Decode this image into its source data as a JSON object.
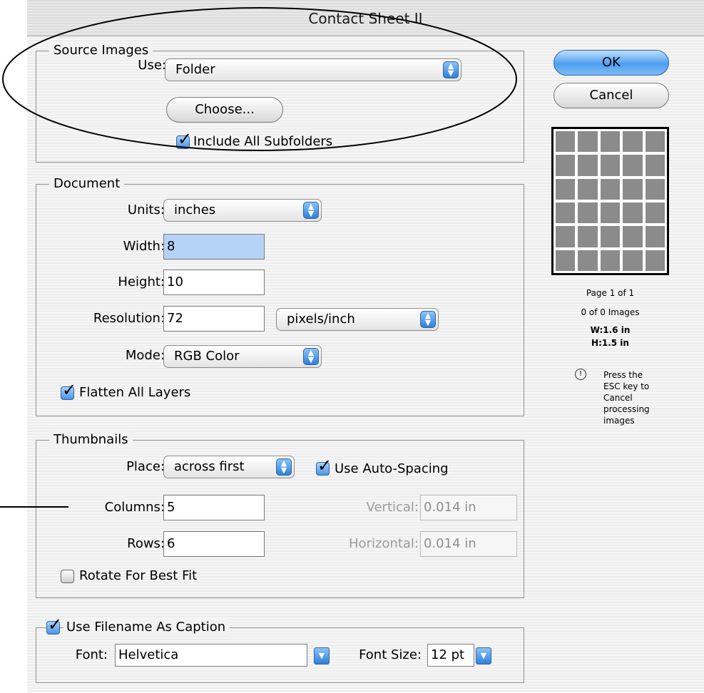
{
  "window": {
    "title": "Contact Sheet II"
  },
  "source_images": {
    "legend": "Source Images",
    "use_label": "Use:",
    "use_value": "Folder",
    "choose_button": "Choose...",
    "include_subfolders_label": "Include All Subfolders",
    "include_subfolders_checked": true
  },
  "document": {
    "legend": "Document",
    "units_label": "Units:",
    "units_value": "inches",
    "width_label": "Width:",
    "width_value": "8",
    "height_label": "Height:",
    "height_value": "10",
    "resolution_label": "Resolution:",
    "resolution_value": "72",
    "resolution_units": "pixels/inch",
    "mode_label": "Mode:",
    "mode_value": "RGB Color",
    "flatten_label": "Flatten All Layers",
    "flatten_checked": true
  },
  "thumbnails": {
    "legend": "Thumbnails",
    "place_label": "Place:",
    "place_value": "across first",
    "auto_spacing_label": "Use Auto-Spacing",
    "auto_spacing_checked": true,
    "columns_label": "Columns:",
    "columns_value": "5",
    "rows_label": "Rows:",
    "rows_value": "6",
    "vertical_label": "Vertical:",
    "vertical_value": "0.014 in",
    "horizontal_label": "Horizontal:",
    "horizontal_value": "0.014 in",
    "rotate_label": "Rotate For Best Fit",
    "rotate_checked": false
  },
  "caption": {
    "use_filename_label": "Use Filename As Caption",
    "use_filename_checked": true,
    "font_label": "Font:",
    "font_value": "Helvetica",
    "font_size_label": "Font Size:",
    "font_size_value": "12 pt"
  },
  "buttons": {
    "ok": "OK",
    "cancel": "Cancel"
  },
  "preview": {
    "columns": 5,
    "rows": 6,
    "page_info": "Page 1 of 1",
    "images_info": "0 of 0 Images",
    "width_info": "W:1.6 in",
    "height_info": "H:1.5 in",
    "note_lines": [
      "Press the",
      "ESC key to",
      "Cancel",
      "processing",
      "images"
    ]
  }
}
